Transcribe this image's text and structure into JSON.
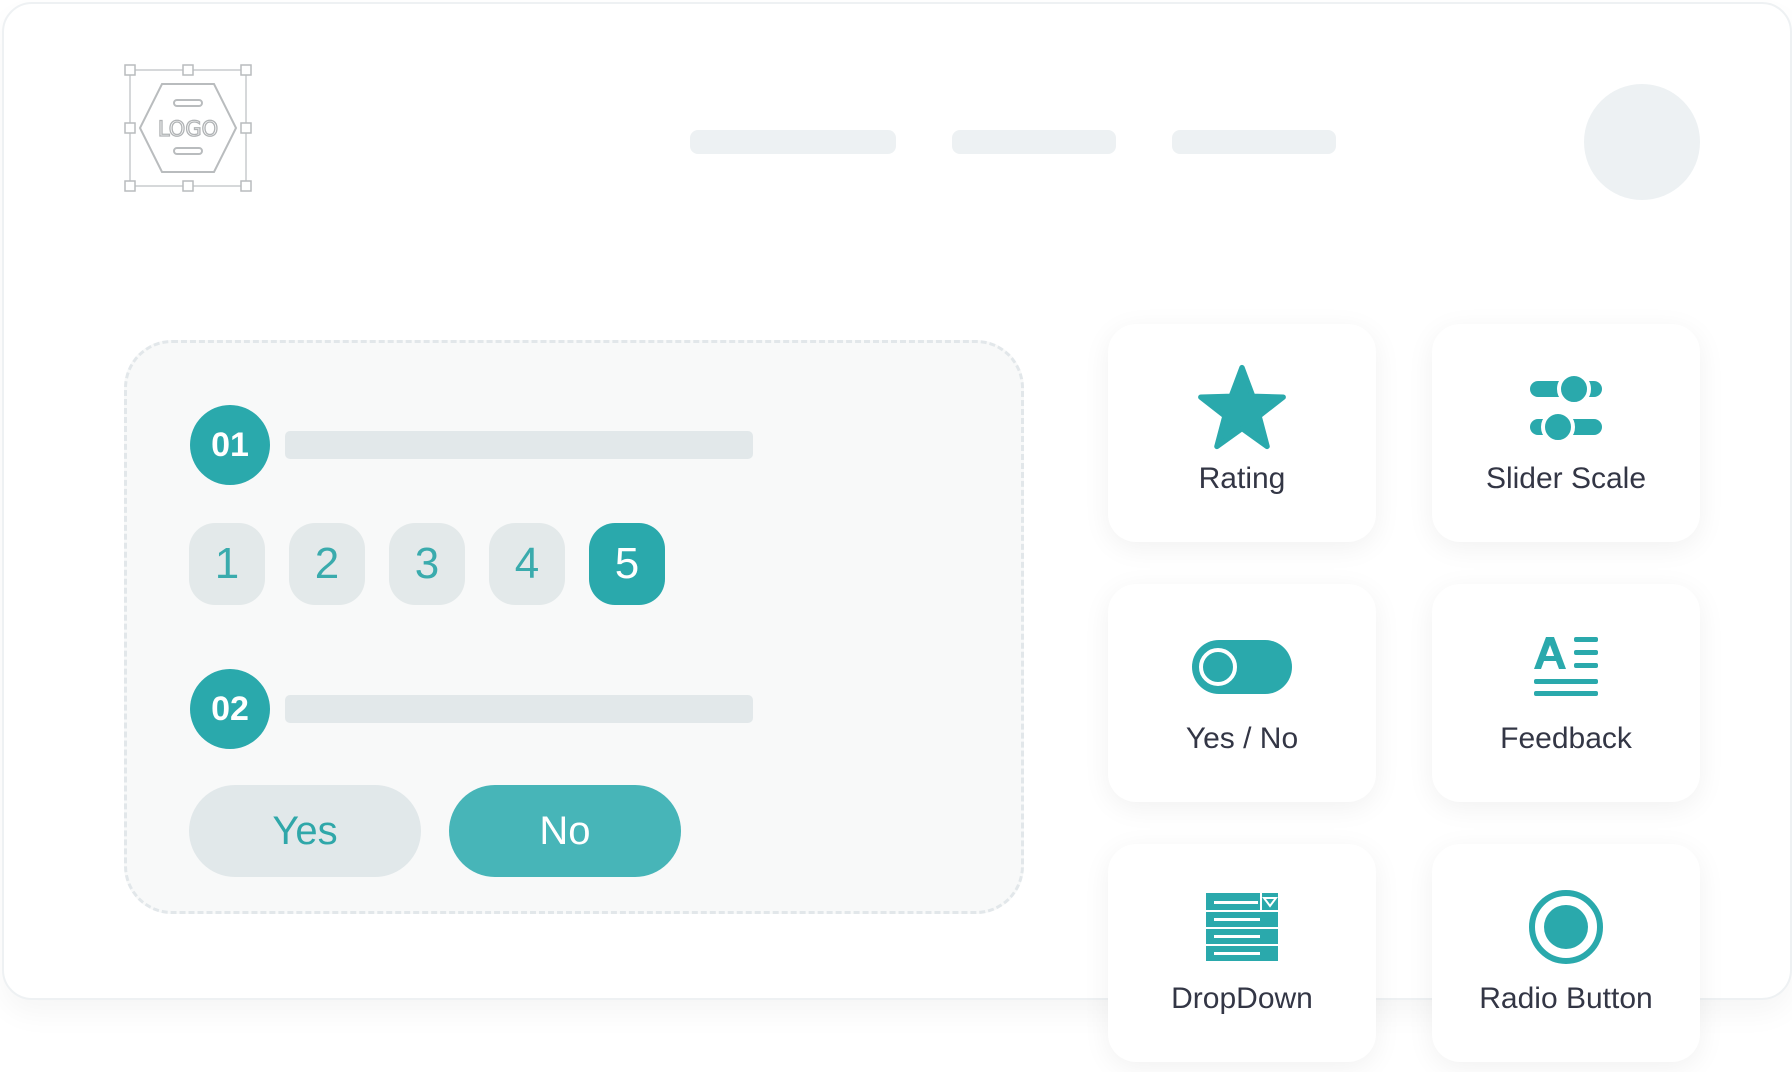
{
  "header": {
    "logo_text": "LOGO"
  },
  "survey": {
    "questions": [
      {
        "number": "01"
      },
      {
        "number": "02"
      }
    ],
    "rating_options": [
      "1",
      "2",
      "3",
      "4",
      "5"
    ],
    "rating_selected": "5",
    "yes_label": "Yes",
    "no_label": "No",
    "yes_no_selected": "No"
  },
  "question_types": [
    {
      "label": "Rating",
      "icon": "star-icon"
    },
    {
      "label": "Slider Scale",
      "icon": "slider-scale-icon"
    },
    {
      "label": "Yes / No",
      "icon": "toggle-icon"
    },
    {
      "label": "Feedback",
      "icon": "feedback-text-icon"
    },
    {
      "label": "DropDown",
      "icon": "dropdown-list-icon"
    },
    {
      "label": "Radio Button",
      "icon": "radio-button-icon"
    }
  ],
  "colors": {
    "accent": "#2aa9ac",
    "accent_light": "#47b5b8",
    "placeholder": "#edf1f3",
    "text": "#333645"
  }
}
